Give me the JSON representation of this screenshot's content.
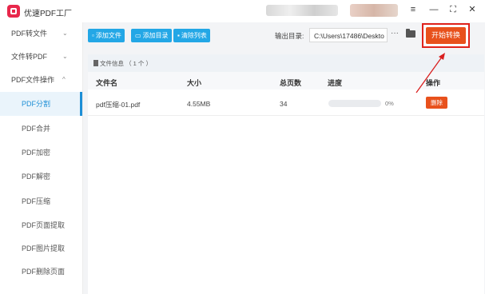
{
  "app": {
    "title": "优速PDF工厂"
  },
  "window_controls": {
    "menu": "≡",
    "minimize": "—",
    "maximize": "⛶",
    "close": "✕"
  },
  "sidebar": {
    "groups": [
      {
        "label": "PDF转文件",
        "chevron": "⌄"
      },
      {
        "label": "文件转PDF",
        "chevron": "⌄"
      },
      {
        "label": "PDF文件操作",
        "chevron": "^"
      }
    ],
    "items": [
      {
        "label": "PDF分割",
        "active": true
      },
      {
        "label": "PDF合并"
      },
      {
        "label": "PDF加密"
      },
      {
        "label": "PDF解密"
      },
      {
        "label": "PDF压缩"
      },
      {
        "label": "PDF页面提取"
      },
      {
        "label": "PDF图片提取"
      },
      {
        "label": "PDF删除页面"
      }
    ]
  },
  "toolbar": {
    "add_file": "添加文件",
    "add_folder": "添加目录",
    "clear_list": "清除列表",
    "output_label": "输出目录:",
    "output_path": "C:\\Users\\17486\\Deskto",
    "more": "···",
    "start": "开始转换"
  },
  "file_info": {
    "label": "文件信息 （ 1 个 ）"
  },
  "table": {
    "headers": {
      "name": "文件名",
      "size": "大小",
      "pages": "总页数",
      "progress": "进度",
      "action": "操作"
    },
    "rows": [
      {
        "name": "pdf压缩-01.pdf",
        "size": "4.55MB",
        "pages": "34",
        "progress_pct": "0%",
        "progress_value": 0,
        "delete": "删除"
      }
    ]
  },
  "colors": {
    "accent_blue": "#23a7e6",
    "action_orange": "#e8511c",
    "highlight_red": "#e0221b"
  }
}
